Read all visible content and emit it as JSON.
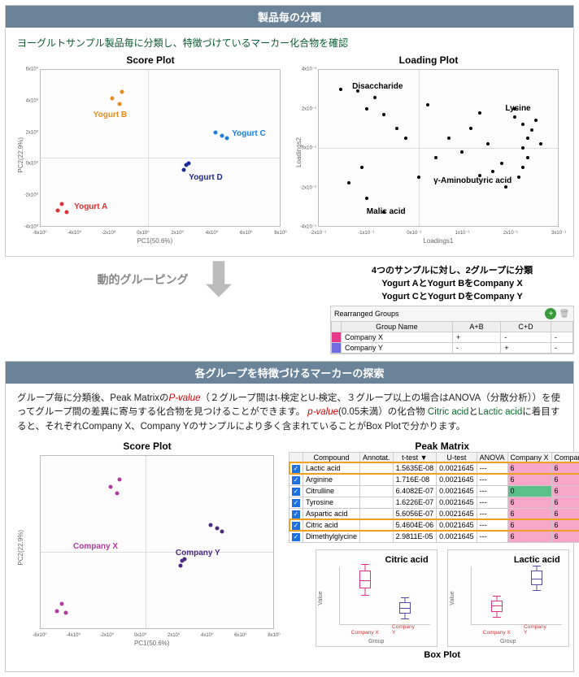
{
  "panel1": {
    "title": "製品毎の分類",
    "intro": "ヨーグルトサンプル製品毎に分類し、特徴づけているマーカー化合物を確認",
    "score_title": "Score Plot",
    "loading_title": "Loading Plot",
    "score": {
      "xlabel": "PC1(50.6%)",
      "ylabel": "PC2(22.9%)",
      "xticks": [
        "-6x10⁰",
        "-4x10⁰",
        "-2x10⁰",
        "0x10⁰",
        "2x10⁰",
        "4x10⁰",
        "6x10⁰",
        "8x10⁰"
      ],
      "yticks": [
        "6x10⁰",
        "4x10⁰",
        "2x10⁰",
        "0x10⁰",
        "-2x10⁰",
        "-4x10⁰"
      ],
      "labels": {
        "a": "Yogurt A",
        "b": "Yogurt B",
        "c": "Yogurt C",
        "d": "Yogurt D"
      }
    },
    "loading": {
      "xlabel": "Loadings1",
      "ylabel": "Loadings2",
      "xticks": [
        "-2x10⁻¹",
        "-1x10⁻¹",
        "0x10⁻¹",
        "1x10⁻¹",
        "2x10⁻¹",
        "3x10⁻¹"
      ],
      "yticks": [
        "4x10⁻¹",
        "2x10⁻¹",
        "0x10⁻¹",
        "-2x10⁻¹",
        "-4x10⁻¹"
      ],
      "labels": {
        "dis": "Disaccharide",
        "lys": "Lysine",
        "gaba": "γ-Aminobutyric acid",
        "mal": "Malic acid"
      }
    }
  },
  "between": {
    "dyn_label": "動的グルーピング",
    "txt1": "4つのサンプルに対し、2グループに分類",
    "txt2": "Yogurt AとYogurt BをCompany X",
    "txt3": "Yogurt CとYogurt DをCompany Y",
    "table_title": "Rearranged Groups",
    "headers": [
      "",
      "Group Name",
      "A+B",
      "C+D",
      ""
    ],
    "rows": [
      {
        "color": "mag",
        "name": "Company X",
        "ab": "+",
        "cd": "-",
        "ext": "-"
      },
      {
        "color": "blu",
        "name": "Company Y",
        "ab": "-",
        "cd": "+",
        "ext": "-"
      }
    ]
  },
  "panel2": {
    "title": "各グループを特徴づけるマーカーの探索",
    "para_parts": {
      "p1": "グループ毎に分類後、Peak Matrixの",
      "pval": "P-value",
      "p2": "（２グループ間はt-検定とU-検定、３グループ以上の場合はANOVA（分散分析））を使ってグループ間の差異に寄与する化合物を見つけることができます。",
      "pval2": "p-value",
      "p3": "(0.05未満）の化合物",
      "c1": " Citric acid",
      "p4": "と",
      "c2": "Lactic acid",
      "p5": "に着目すると、それぞれCompany X、Company Yのサンプルにより多く含まれていることがBox Plotで分かります。"
    },
    "score_title": "Score Plot",
    "pm_title": "Peak Matrix",
    "score": {
      "xlabel": "PC1(50.6%)",
      "ylabel": "PC2(22.9%)",
      "xticks": [
        "-6x10⁰",
        "-4x10⁰",
        "-2x10⁰",
        "0x10⁰",
        "2x10⁰",
        "4x10⁰",
        "6x10⁰",
        "8x10⁰"
      ],
      "labels": {
        "x": "Company X",
        "y": "Company Y"
      }
    },
    "pm": {
      "headers": [
        "",
        "Compound",
        "Annotat.",
        "t-test ▼",
        "U-test",
        "ANOVA",
        "Company X",
        "Company Y"
      ],
      "rows": [
        {
          "hl": true,
          "c": "Lactic acid",
          "a": "",
          "t": "1.5635E-08",
          "u": "0.0021645",
          "an": "---",
          "cx": "6",
          "cy": "6"
        },
        {
          "hl": false,
          "c": "Arginine",
          "a": "",
          "t": "1.716E-08",
          "u": "0.0021645",
          "an": "---",
          "cx": "6",
          "cy": "6"
        },
        {
          "hl": false,
          "c": "Citrulline",
          "a": "",
          "t": "6.4082E-07",
          "u": "0.0021645",
          "an": "---",
          "cx": "0",
          "cy": "6",
          "cxcls": "green"
        },
        {
          "hl": false,
          "c": "Tyrosine",
          "a": "",
          "t": "1.6226E-07",
          "u": "0.0021645",
          "an": "---",
          "cx": "6",
          "cy": "6"
        },
        {
          "hl": false,
          "c": "Aspartic acid",
          "a": "",
          "t": "5.6056E-07",
          "u": "0.0021645",
          "an": "---",
          "cx": "6",
          "cy": "6"
        },
        {
          "hl": true,
          "c": "Citric acid",
          "a": "",
          "t": "5.4604E-06",
          "u": "0.0021645",
          "an": "---",
          "cx": "6",
          "cy": "6"
        },
        {
          "hl": false,
          "c": "Dimethylglycine",
          "a": "",
          "t": "2.9811E-05",
          "u": "0.0021645",
          "an": "---",
          "cx": "6",
          "cy": "6"
        }
      ]
    },
    "box": {
      "caption": "Box Plot",
      "citric": {
        "title": "Citric acid",
        "y": "Value",
        "x": "Group",
        "g1": "Company X",
        "g2": "Company Y"
      },
      "lactic": {
        "title": "Lactic acid",
        "y": "Value",
        "x": "Group",
        "g1": "Company X",
        "g2": "Company Y"
      }
    }
  },
  "chart_data": [
    {
      "type": "scatter",
      "title": "Score Plot (products)",
      "xlabel": "PC1(50.6%)",
      "ylabel": "PC2(22.9%)",
      "xlim": [
        -6,
        8
      ],
      "ylim": [
        -5,
        6
      ],
      "series": [
        {
          "name": "Yogurt A",
          "color": "#d33",
          "points": [
            [
              -5.2,
              -3.6
            ],
            [
              -5.6,
              -4.1
            ],
            [
              -5.0,
              -4.3
            ]
          ]
        },
        {
          "name": "Yogurt B",
          "color": "#e88a1a",
          "points": [
            [
              -2.2,
              3.9
            ],
            [
              -1.5,
              4.4
            ],
            [
              -1.7,
              3.5
            ]
          ]
        },
        {
          "name": "Yogurt C",
          "color": "#1b7fe0",
          "points": [
            [
              4.5,
              1.3
            ],
            [
              4.0,
              1.6
            ],
            [
              4.8,
              1.0
            ]
          ]
        },
        {
          "name": "Yogurt D",
          "color": "#1b2a9a",
          "points": [
            [
              2.5,
              -0.5
            ],
            [
              2.2,
              -1.0
            ],
            [
              2.3,
              -0.6
            ]
          ]
        }
      ]
    },
    {
      "type": "scatter",
      "title": "Loading Plot",
      "xlabel": "Loadings1",
      "ylabel": "Loadings2",
      "xlim": [
        -0.25,
        0.3
      ],
      "ylim": [
        -0.4,
        0.4
      ],
      "annotations": [
        "Disaccharide",
        "Lysine",
        "γ-Aminobutyric acid",
        "Malic acid"
      ],
      "series": [
        {
          "name": "loadings",
          "color": "#000",
          "points": [
            [
              -0.2,
              0.3
            ],
            [
              -0.16,
              0.29
            ],
            [
              -0.12,
              0.26
            ],
            [
              -0.14,
              0.2
            ],
            [
              -0.1,
              0.17
            ],
            [
              -0.07,
              0.1
            ],
            [
              -0.15,
              -0.1
            ],
            [
              -0.18,
              -0.18
            ],
            [
              -0.14,
              -0.26
            ],
            [
              -0.1,
              -0.33
            ],
            [
              0.12,
              0.18
            ],
            [
              0.2,
              0.16
            ],
            [
              0.22,
              0.12
            ],
            [
              0.24,
              0.09
            ],
            [
              0.23,
              0.05
            ],
            [
              0.22,
              0.0
            ],
            [
              0.23,
              -0.05
            ],
            [
              0.22,
              -0.1
            ],
            [
              0.21,
              -0.15
            ],
            [
              0.15,
              -0.12
            ],
            [
              0.12,
              -0.14
            ],
            [
              0.05,
              0.05
            ],
            [
              0.08,
              -0.02
            ],
            [
              0.02,
              -0.05
            ],
            [
              0.1,
              0.1
            ],
            [
              0.18,
              -0.2
            ],
            [
              0.2,
              0.2
            ],
            [
              0.0,
              0.22
            ],
            [
              -0.05,
              0.05
            ],
            [
              -0.02,
              -0.15
            ],
            [
              0.14,
              0.02
            ],
            [
              0.17,
              -0.08
            ],
            [
              0.25,
              0.14
            ],
            [
              0.26,
              0.02
            ]
          ]
        }
      ]
    },
    {
      "type": "scatter",
      "title": "Score Plot (companies)",
      "xlabel": "PC1(50.6%)",
      "ylabel": "PC2(22.9%)",
      "xlim": [
        -6,
        8
      ],
      "ylim": [
        -5,
        6
      ],
      "series": [
        {
          "name": "Company X",
          "color": "#b33aa0",
          "points": [
            [
              -5.2,
              -3.6
            ],
            [
              -5.6,
              -4.1
            ],
            [
              -5.0,
              -4.3
            ],
            [
              -2.2,
              3.9
            ],
            [
              -1.5,
              4.4
            ],
            [
              -1.7,
              3.5
            ]
          ]
        },
        {
          "name": "Company Y",
          "color": "#4a2a80",
          "points": [
            [
              4.5,
              1.3
            ],
            [
              4.0,
              1.6
            ],
            [
              4.8,
              1.0
            ],
            [
              2.5,
              -0.5
            ],
            [
              2.2,
              -1.0
            ],
            [
              2.3,
              -0.6
            ]
          ]
        }
      ]
    },
    {
      "type": "table",
      "title": "Peak Matrix",
      "columns": [
        "Compound",
        "t-test",
        "U-test",
        "ANOVA",
        "Company X",
        "Company Y"
      ],
      "rows": [
        [
          "Lactic acid",
          "1.5635E-08",
          "0.0021645",
          "---",
          6,
          6
        ],
        [
          "Arginine",
          "1.716E-08",
          "0.0021645",
          "---",
          6,
          6
        ],
        [
          "Citrulline",
          "6.4082E-07",
          "0.0021645",
          "---",
          0,
          6
        ],
        [
          "Tyrosine",
          "1.6226E-07",
          "0.0021645",
          "---",
          6,
          6
        ],
        [
          "Aspartic acid",
          "5.6056E-07",
          "0.0021645",
          "---",
          6,
          6
        ],
        [
          "Citric acid",
          "5.4604E-06",
          "0.0021645",
          "---",
          6,
          6
        ],
        [
          "Dimethylglycine",
          "2.9811E-05",
          "0.0021645",
          "---",
          6,
          6
        ]
      ]
    },
    {
      "type": "box",
      "title": "Citric acid",
      "xlabel": "Group",
      "ylabel": "Value",
      "categories": [
        "Company X",
        "Company Y"
      ],
      "series": [
        {
          "name": "Company X",
          "color": "#d63384",
          "q1": 2700000.0,
          "median": 2900000.0,
          "q3": 3300000.0,
          "min": 2500000.0,
          "max": 3600000.0
        },
        {
          "name": "Company Y",
          "color": "#5a4aa0",
          "q1": 600000.0,
          "median": 700000.0,
          "q3": 800000.0,
          "min": 500000.0,
          "max": 900000.0
        }
      ],
      "ylim": [
        0,
        4000000.0
      ]
    },
    {
      "type": "box",
      "title": "Lactic acid",
      "xlabel": "Group",
      "ylabel": "Value",
      "categories": [
        "Company X",
        "Company Y"
      ],
      "series": [
        {
          "name": "Company X",
          "color": "#d63384",
          "q1": 7000000.0,
          "median": 7400000.0,
          "q3": 7800000.0,
          "min": 6600000.0,
          "max": 8200000.0
        },
        {
          "name": "Company Y",
          "color": "#5a4aa0",
          "q1": 15500000.0,
          "median": 16000000.0,
          "q3": 16800000.0,
          "min": 15000000.0,
          "max": 17200000.0
        }
      ],
      "ylim": [
        5000000.0,
        18000000.0
      ]
    }
  ]
}
